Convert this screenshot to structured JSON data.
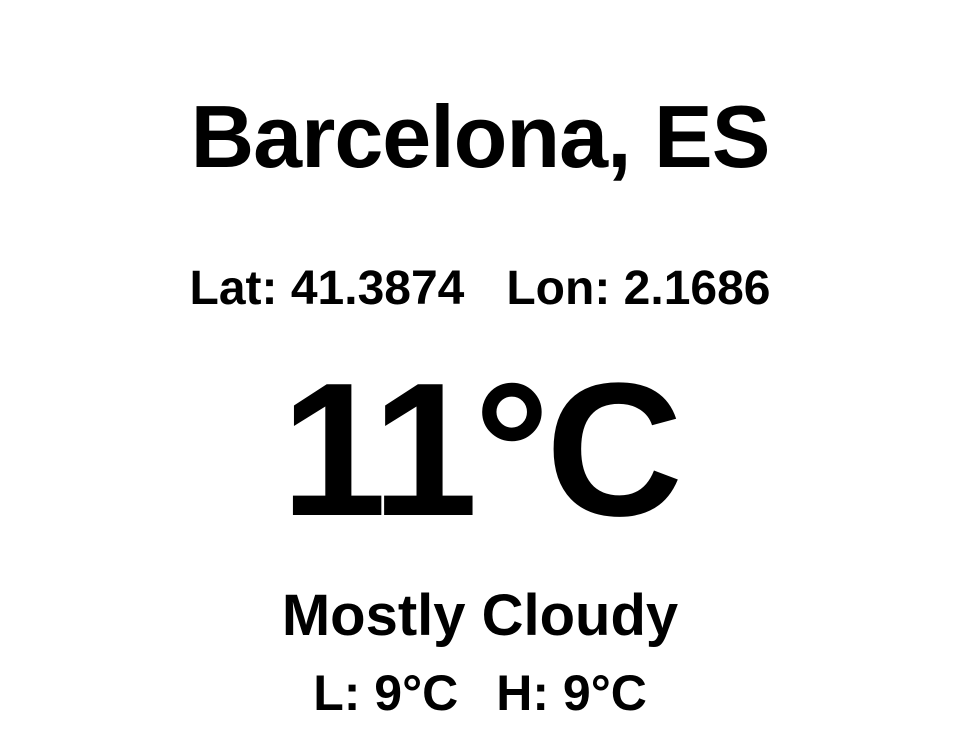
{
  "location": {
    "city_label": "Barcelona, ES"
  },
  "coordinates": {
    "lat_label": "Lat:",
    "lat_value": "41.3874",
    "lon_label": "Lon:",
    "lon_value": "2.1686"
  },
  "current": {
    "temperature": "11°C",
    "condition": "Mostly Cloudy"
  },
  "range": {
    "low_label": "L:",
    "low_value": "9°C",
    "high_label": "H:",
    "high_value": "9°C"
  },
  "colors": {
    "background": "#ffffff",
    "text": "#000000"
  }
}
